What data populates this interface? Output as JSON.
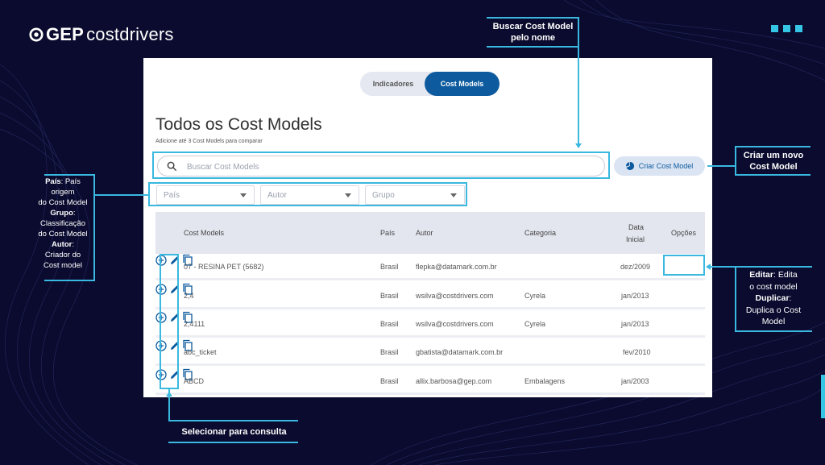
{
  "brand": {
    "prefix": "GEP",
    "name": "costdrivers"
  },
  "app": {
    "toggle": {
      "option_1": "Indicadores",
      "option_2": "Cost Models",
      "active": "Cost Models"
    },
    "title": "Todos os Cost Models",
    "subtitle": "Adicione até 3 Cost Models para comparar",
    "search": {
      "placeholder": "Buscar Cost Models",
      "value": ""
    },
    "create_button": "Criar Cost Model",
    "filters": {
      "pais": "País",
      "autor": "Autor",
      "grupo": "Grupo"
    },
    "table": {
      "columns": {
        "cost_models": "Cost Models",
        "pais": "País",
        "autor": "Autor",
        "categoria": "Categoria",
        "data_inicial_1": "Data",
        "data_inicial_2": "Inicial",
        "opcoes": "Opções"
      },
      "rows": [
        {
          "name": "07 - RESINA PET (5682)",
          "pais": "Brasil",
          "autor": "flepka@datamark.com.br",
          "categoria": "",
          "data": "dez/2009"
        },
        {
          "name": "2,4",
          "pais": "Brasil",
          "autor": "wsilva@costdrivers.com",
          "categoria": "Cyrela",
          "data": "jan/2013"
        },
        {
          "name": "2,4111",
          "pais": "Brasil",
          "autor": "wsilva@costdrivers.com",
          "categoria": "Cyrela",
          "data": "jan/2013"
        },
        {
          "name": "abc_ticket",
          "pais": "Brasil",
          "autor": "gbatista@datamark.com.br",
          "categoria": "",
          "data": "fev/2010"
        },
        {
          "name": "ABCD",
          "pais": "Brasil",
          "autor": "allix.barbosa@gep.com",
          "categoria": "Embalagens",
          "data": "jan/2003"
        }
      ]
    }
  },
  "annotations": {
    "search_1": "Buscar Cost Model",
    "search_2": "pelo nome",
    "create_1": "Criar um novo",
    "create_2": "Cost Model",
    "filters": {
      "pais_label": "País",
      "pais_text_1": ": País",
      "pais_text_2": "origem",
      "pais_text_3": "do Cost Model",
      "grupo_label": "Grupo",
      "grupo_text_1": ":",
      "grupo_text_2": "Classificação",
      "grupo_text_3": "do Cost Model",
      "autor_label": "Autor",
      "autor_text_1": ":",
      "autor_text_2": "Criador do",
      "autor_text_3": "Cost model"
    },
    "options": {
      "editar_label": "Editar",
      "editar_text_1": ": Edita",
      "editar_text_2": "o cost model",
      "duplicar_label": "Duplicar",
      "duplicar_text_1": ":",
      "duplicar_text_2": "Duplica o Cost",
      "duplicar_text_3": "Model"
    },
    "select": "Selecionar para consulta"
  },
  "colors": {
    "background": "#0a0b2e",
    "accent": "#3ab8e0",
    "primary_button": "#0d5b9e"
  }
}
